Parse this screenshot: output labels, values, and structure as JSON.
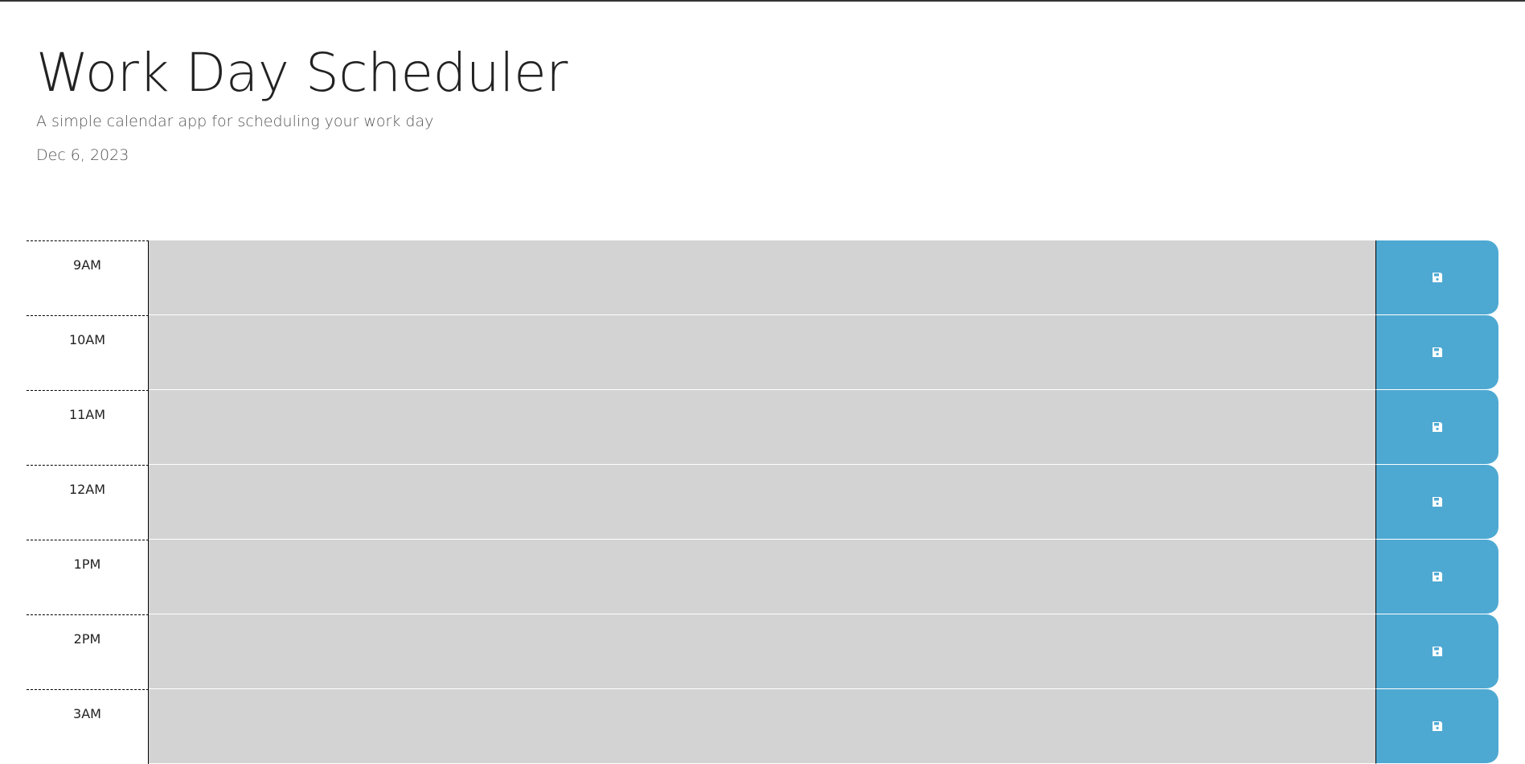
{
  "header": {
    "title": "Work Day Scheduler",
    "subtitle": "A simple calendar app for scheduling your work day",
    "date": "Dec 6, 2023"
  },
  "colors": {
    "row_background": "#d3d3d3",
    "save_button": "#4ea9d2",
    "save_icon": "#ffffff"
  },
  "icons": {
    "save": "floppy-disk-icon"
  },
  "time_blocks": [
    {
      "hour": "9AM",
      "text": ""
    },
    {
      "hour": "10AM",
      "text": ""
    },
    {
      "hour": "11AM",
      "text": ""
    },
    {
      "hour": "12AM",
      "text": ""
    },
    {
      "hour": "1PM",
      "text": ""
    },
    {
      "hour": "2PM",
      "text": ""
    },
    {
      "hour": "3AM",
      "text": ""
    }
  ]
}
